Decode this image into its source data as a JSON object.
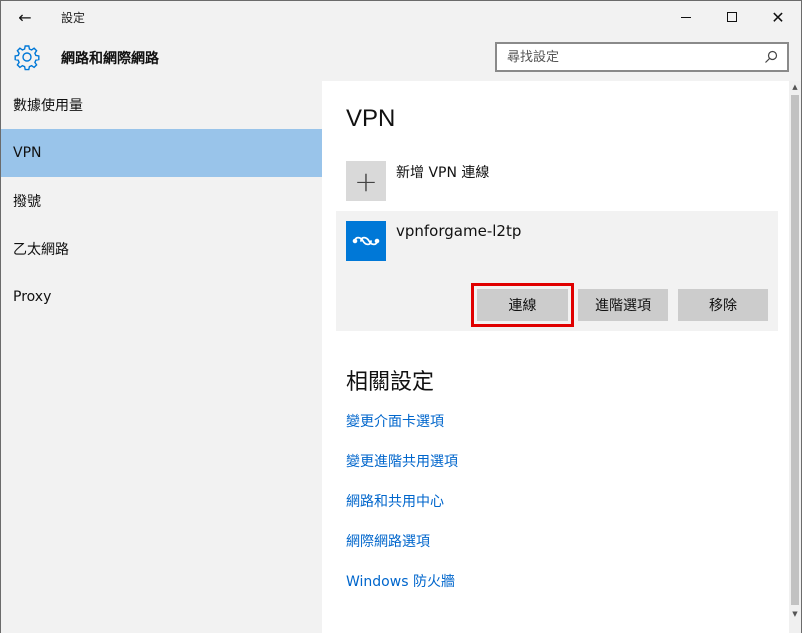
{
  "window": {
    "title": "設定",
    "back_glyph": "←",
    "close_glyph": "✕"
  },
  "header": {
    "title": "網路和網際網路",
    "search_placeholder": "尋找設定"
  },
  "sidebar": {
    "items": [
      {
        "label": "數據使用量",
        "active": false
      },
      {
        "label": "VPN",
        "active": true
      },
      {
        "label": "撥號",
        "active": false
      },
      {
        "label": "乙太網路",
        "active": false
      },
      {
        "label": "Proxy",
        "active": false
      }
    ]
  },
  "main": {
    "title": "VPN",
    "add_vpn": {
      "icon_glyph": "+",
      "label": "新增 VPN 連線"
    },
    "vpn_connection": {
      "name": "vpnforgame-l2tp",
      "buttons": {
        "connect": "連線",
        "advanced": "進階選項",
        "remove": "移除"
      }
    },
    "related": {
      "title": "相關設定",
      "links": [
        "變更介面卡選項",
        "變更進階共用選項",
        "網路和共用中心",
        "網際網路選項",
        "Windows 防火牆"
      ]
    }
  },
  "colors": {
    "accent": "#0078d7",
    "sidebar_active": "#99c4ea",
    "link": "#0066cc",
    "highlight": "#e00000"
  },
  "icons": {
    "back": "back-arrow-icon",
    "settings": "gear-icon",
    "search": "search-icon",
    "vpn": "vpn-icon",
    "add": "plus-icon"
  }
}
